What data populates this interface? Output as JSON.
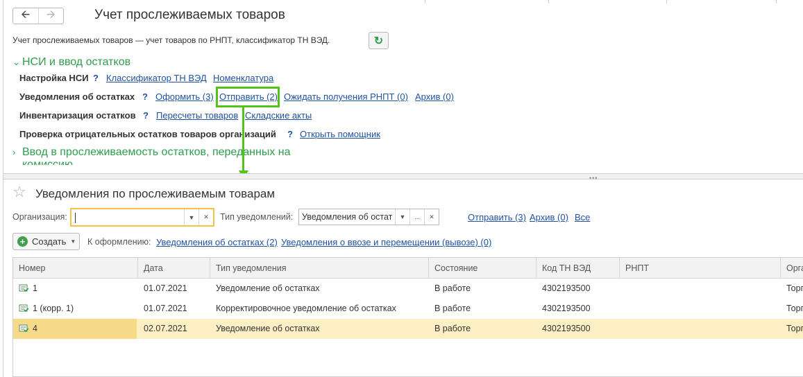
{
  "window": {
    "title": "Учет прослеживаемых товаров",
    "description": "Учет прослеживаемых товаров — учет товаров по РНПТ, классификатор ТН ВЭД.",
    "back_icon": "arrow-left-icon",
    "forward_icon": "arrow-right-icon",
    "refresh_icon": "refresh-icon"
  },
  "sections": {
    "nsi_group": "НСИ и ввод остатков",
    "nsi_setup": {
      "label": "Настройка НСИ",
      "help": "?",
      "links": [
        "Классификатор ТН ВЭД",
        "Номенклатура"
      ]
    },
    "notifications": {
      "label": "Уведомления об остатках",
      "help": "?",
      "links": [
        "Оформить (3)",
        "Отправить (2)",
        "Ожидать получения РНПТ (0)",
        "Архив (0)"
      ]
    },
    "inventory": {
      "label": "Инвентаризация остатков",
      "help": "?",
      "links": [
        "Пересчеты товаров",
        "Складские акты"
      ]
    },
    "negative_check": {
      "label": "Проверка отрицательных остатков товаров организаций",
      "help": "?",
      "links": [
        "Открыть помощник"
      ]
    },
    "commission_group_line1": "Ввод в прослеживаемость остатков, переданных на",
    "commission_group_line2": "комиссию"
  },
  "list": {
    "title": "Уведомления по прослеживаемым товарам",
    "favorite_icon": "star-icon",
    "filters": {
      "org_label": "Организация:",
      "org_value": "",
      "type_label": "Тип уведомлений:",
      "type_value": "Уведомления об остат",
      "links": [
        "Отправить (3)",
        "Архив (0)",
        "Все"
      ]
    },
    "toolbar": {
      "create_label": "Создать",
      "to_process_label": "К оформлению:",
      "to_process_links": [
        "Уведомления об остатках (2)",
        "Уведомления о ввозе и перемещении (вывозе) (0)"
      ]
    },
    "columns": [
      "Номер",
      "Дата",
      "Тип уведомления",
      "Состояние",
      "Код ТН ВЭД",
      "РНПТ",
      "Орга"
    ],
    "rows": [
      {
        "number": "1",
        "date": "01.07.2021",
        "type": "Уведомление об остатках",
        "state": "В работе",
        "code": "4302193500",
        "rnpt": "",
        "org": "Торг"
      },
      {
        "number": "1 (корр. 1)",
        "date": "01.07.2021",
        "type": "Корректировочное уведомление об остатках",
        "state": "В работе",
        "code": "4302193500",
        "rnpt": "",
        "org": "Торг"
      },
      {
        "number": "4",
        "date": "02.07.2021",
        "type": "Уведомление об остатках",
        "state": "В работе",
        "code": "4302193500",
        "rnpt": "",
        "org": "Торг"
      }
    ]
  },
  "colors": {
    "accent_green": "#2e9e4b",
    "highlight_green": "#52c41a",
    "link_blue": "#1f52a3",
    "selected_row": "#fbefc3",
    "focus_yellow": "#f5c242"
  }
}
